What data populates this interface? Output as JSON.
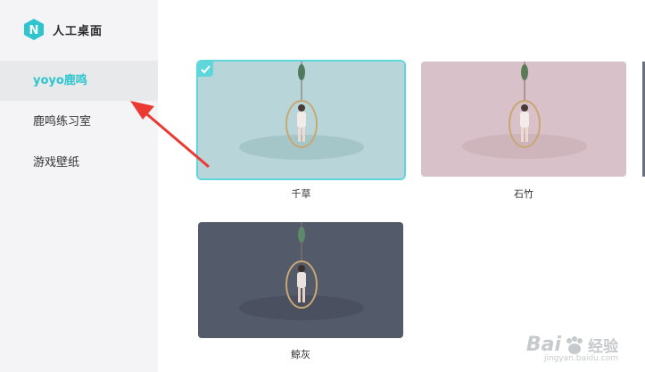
{
  "app": {
    "title": "人工桌面",
    "logo_letter": "N"
  },
  "sidebar": {
    "items": [
      {
        "label": "yoyo鹿鸣",
        "active": true
      },
      {
        "label": "鹿鸣练习室",
        "active": false
      },
      {
        "label": "游戏壁纸",
        "active": false
      }
    ]
  },
  "wallpapers": [
    {
      "label": "千草",
      "bg": "#b8d6d9",
      "selected": true
    },
    {
      "label": "石竹",
      "bg": "#d8c1c8",
      "selected": false
    },
    {
      "label": "鲸灰",
      "bg": "#535a6a",
      "selected": false
    }
  ],
  "watermark": {
    "main": "Bai",
    "cn": "经验",
    "sub": "jingyan.baidu.com"
  },
  "colors": {
    "accent": "#2ec5cf",
    "arrow": "#ea3a32"
  }
}
